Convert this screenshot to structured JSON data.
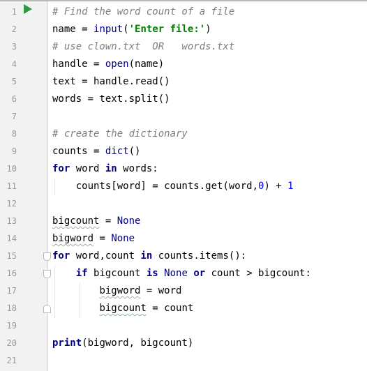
{
  "editor": {
    "line_numbers": [
      "1",
      "2",
      "3",
      "4",
      "5",
      "6",
      "7",
      "8",
      "9",
      "10",
      "11",
      "12",
      "13",
      "14",
      "15",
      "16",
      "17",
      "18",
      "19",
      "20",
      "21"
    ],
    "lines": [
      [
        {
          "t": "# Find the word count of a file",
          "c": "cm"
        }
      ],
      [
        {
          "t": "name = ",
          "c": ""
        },
        {
          "t": "input",
          "c": "bi"
        },
        {
          "t": "(",
          "c": ""
        },
        {
          "t": "'Enter file:'",
          "c": "str"
        },
        {
          "t": ")",
          "c": ""
        }
      ],
      [
        {
          "t": "# use clown.txt  OR   words.txt",
          "c": "cm"
        }
      ],
      [
        {
          "t": "handle = ",
          "c": ""
        },
        {
          "t": "open",
          "c": "bi"
        },
        {
          "t": "(name)",
          "c": ""
        }
      ],
      [
        {
          "t": "text = handle.read()",
          "c": ""
        }
      ],
      [
        {
          "t": "words = text.split()",
          "c": ""
        }
      ],
      [],
      [
        {
          "t": "# create the dictionary",
          "c": "cm"
        }
      ],
      [
        {
          "t": "counts = ",
          "c": ""
        },
        {
          "t": "dict",
          "c": "bi"
        },
        {
          "t": "()",
          "c": ""
        }
      ],
      [
        {
          "t": "for",
          "c": "kw"
        },
        {
          "t": " word ",
          "c": ""
        },
        {
          "t": "in",
          "c": "kw"
        },
        {
          "t": " words:",
          "c": ""
        }
      ],
      [
        {
          "t": "    counts[word] = counts.get(word,",
          "c": ""
        },
        {
          "t": "0",
          "c": "num"
        },
        {
          "t": ") + ",
          "c": ""
        },
        {
          "t": "1",
          "c": "num"
        }
      ],
      [],
      [
        {
          "t": "bigcount",
          "c": "wavy"
        },
        {
          "t": " = ",
          "c": ""
        },
        {
          "t": "None",
          "c": "bi"
        }
      ],
      [
        {
          "t": "bigword",
          "c": "wavy"
        },
        {
          "t": " = ",
          "c": ""
        },
        {
          "t": "None",
          "c": "bi"
        }
      ],
      [
        {
          "t": "for",
          "c": "kw"
        },
        {
          "t": " word,count ",
          "c": ""
        },
        {
          "t": "in",
          "c": "kw"
        },
        {
          "t": " counts.items():",
          "c": ""
        }
      ],
      [
        {
          "t": "    ",
          "c": ""
        },
        {
          "t": "if",
          "c": "kw"
        },
        {
          "t": " bigcount ",
          "c": ""
        },
        {
          "t": "is",
          "c": "kw"
        },
        {
          "t": " ",
          "c": ""
        },
        {
          "t": "None",
          "c": "bi"
        },
        {
          "t": " ",
          "c": ""
        },
        {
          "t": "or",
          "c": "kw"
        },
        {
          "t": " count > bigcount:",
          "c": ""
        }
      ],
      [
        {
          "t": "        ",
          "c": ""
        },
        {
          "t": "bigword",
          "c": "wavy"
        },
        {
          "t": " = word",
          "c": ""
        }
      ],
      [
        {
          "t": "        ",
          "c": ""
        },
        {
          "t": "bigcount",
          "c": "wavy"
        },
        {
          "t": " = count",
          "c": ""
        }
      ],
      [],
      [
        {
          "t": "print",
          "c": "kw"
        },
        {
          "t": "(bigword, bigcount)",
          "c": ""
        }
      ],
      []
    ]
  },
  "icons": {
    "run": "run-triangle-icon",
    "fold_open": "fold-open-icon",
    "fold_close": "fold-close-icon"
  },
  "colors": {
    "keyword": "#000080",
    "string": "#008000",
    "number": "#0000ff",
    "comment": "#808080",
    "run_icon": "#2e9a3f",
    "gutter": "#f2f2f2"
  }
}
